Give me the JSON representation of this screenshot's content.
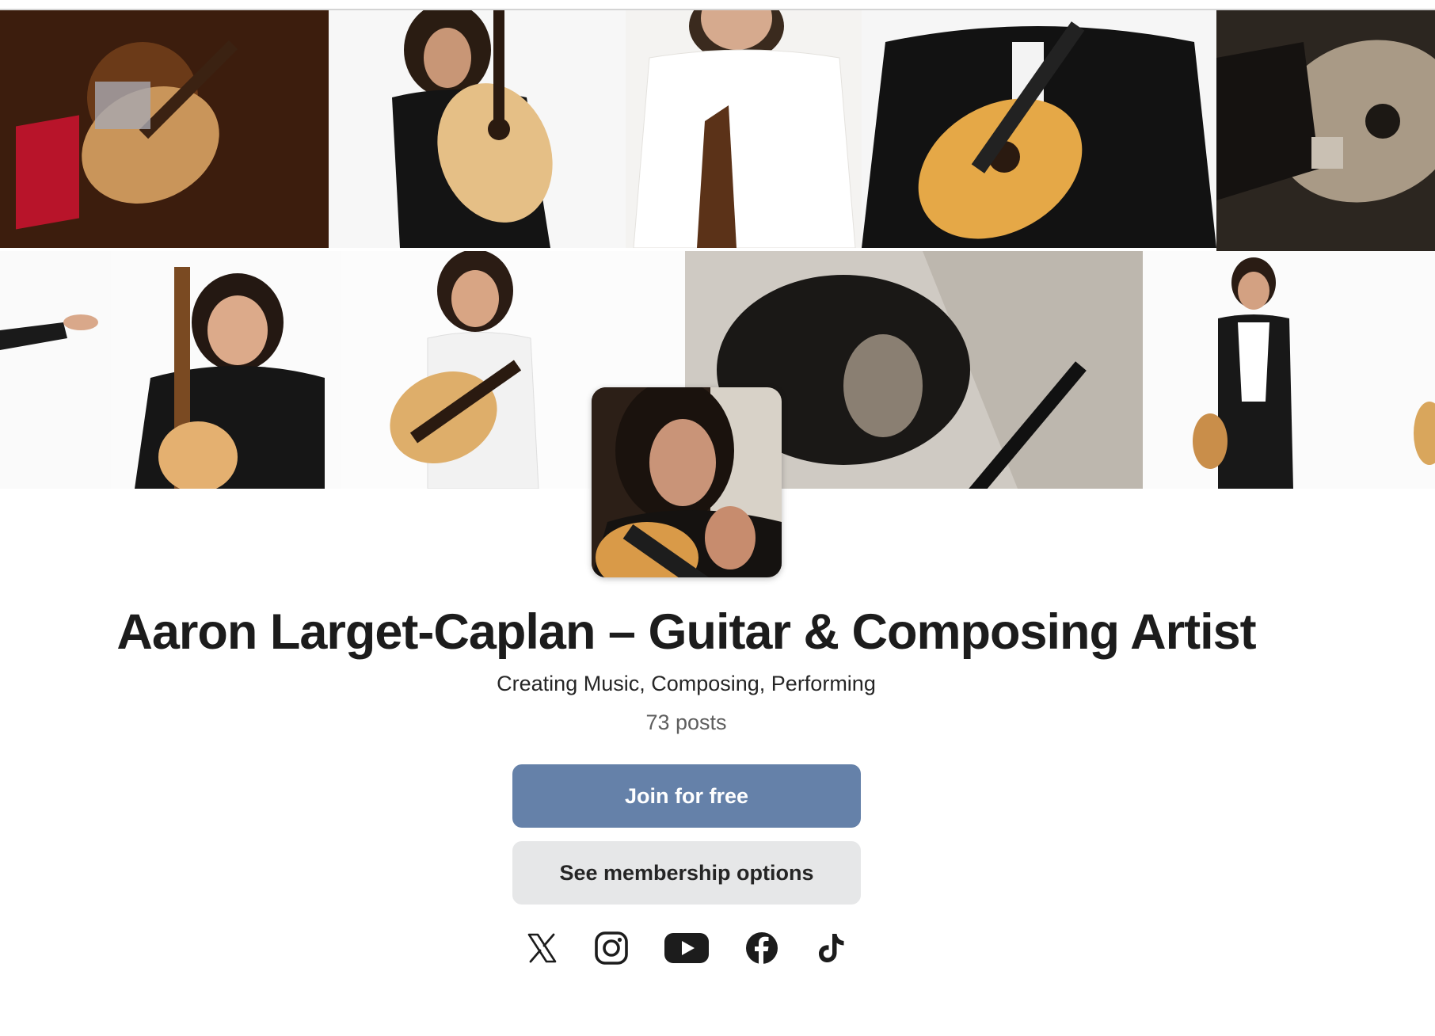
{
  "creator": {
    "name": "Aaron Larget-Caplan – Guitar & Composing Artist",
    "tagline": "Creating Music, Composing, Performing",
    "posts_count": "73 posts"
  },
  "actions": {
    "join_label": "Join for free",
    "membership_label": "See membership options"
  },
  "socials": [
    {
      "name": "x-icon"
    },
    {
      "name": "instagram-icon"
    },
    {
      "name": "youtube-icon"
    },
    {
      "name": "facebook-icon"
    },
    {
      "name": "tiktok-icon"
    }
  ],
  "colors": {
    "primary_button": "#6581a9",
    "secondary_button": "#e6e7e8",
    "text": "#1c1c1c",
    "muted_text": "#5e5e5e"
  }
}
